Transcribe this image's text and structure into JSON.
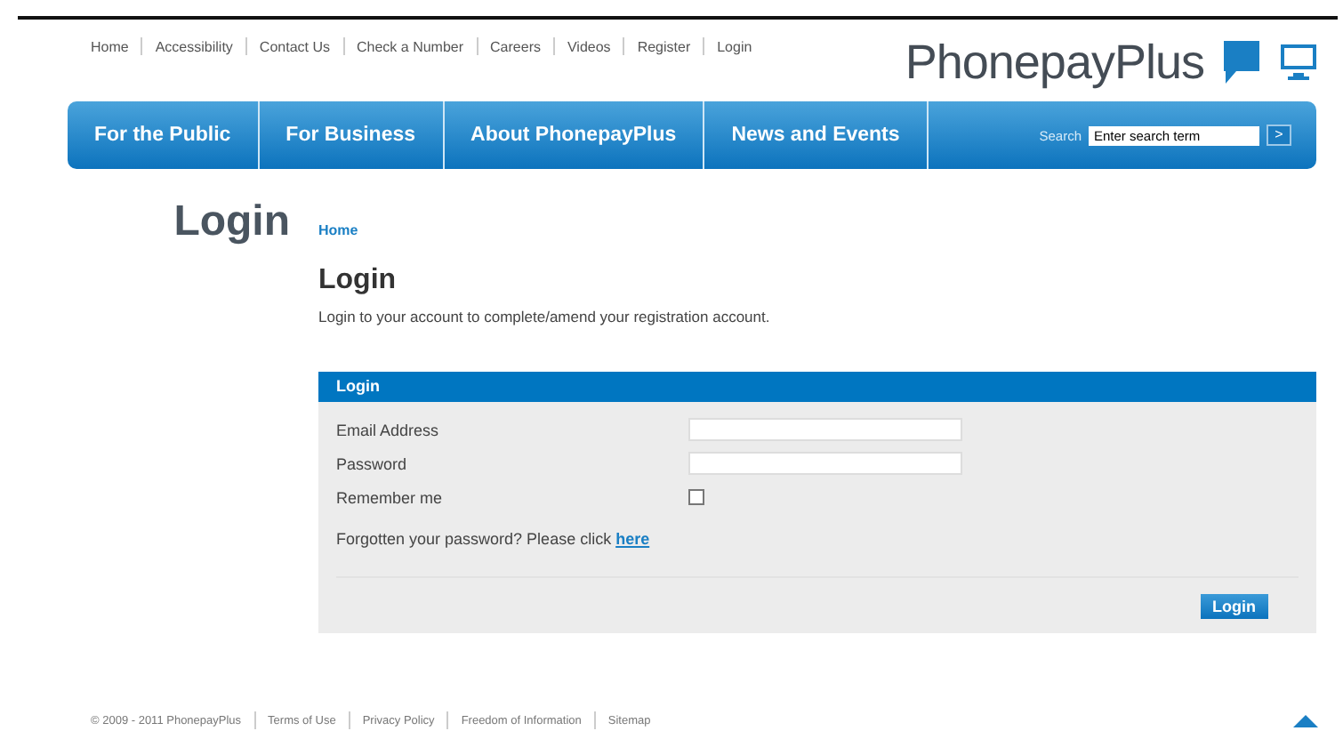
{
  "top_links": [
    "Home",
    "Accessibility",
    "Contact Us",
    "Check a Number",
    "Careers",
    "Videos",
    "Register",
    "Login"
  ],
  "logo": "PhonepayPlus",
  "nav": [
    "For the Public",
    "For Business",
    "About PhonepayPlus",
    "News and Events"
  ],
  "search": {
    "label": "Search",
    "value": "Enter search term",
    "button": ">"
  },
  "page_title": "Login",
  "breadcrumb": "Home",
  "heading": "Login",
  "intro": "Login to your account to complete/amend your registration account.",
  "form": {
    "title": "Login",
    "fields": [
      {
        "kind": "text",
        "label": "Email Address"
      },
      {
        "kind": "text",
        "label": "Password"
      },
      {
        "kind": "checkbox",
        "label": "Remember me",
        "checked": false
      }
    ],
    "forgot_text": "Forgotten your password? Please click",
    "forgot_link": "here",
    "button": "Login"
  },
  "footer": [
    "© 2009 - 2011 PhonepayPlus",
    "Terms of Use",
    "Privacy Policy",
    "Freedom of Information",
    "Sitemap"
  ]
}
